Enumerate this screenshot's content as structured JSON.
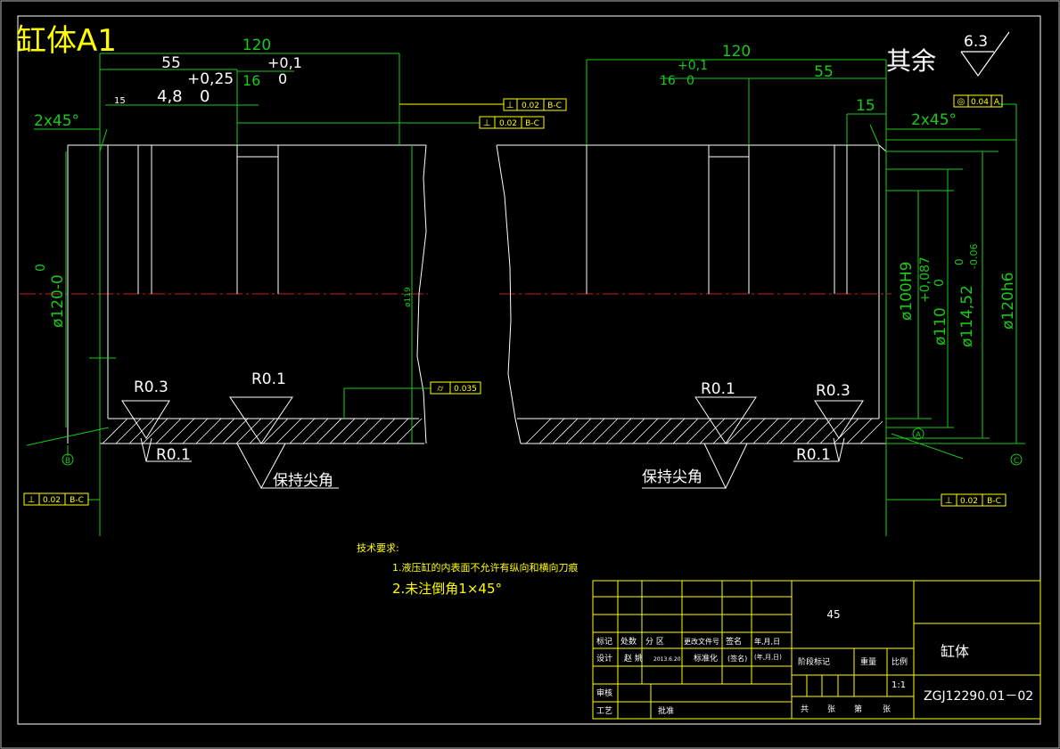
{
  "title": "缸体A1",
  "surface_finish": {
    "label": "其余",
    "value": "6.3"
  },
  "colors": {
    "background": "#000000",
    "dimension": "#19c819",
    "outline": "#ffffff",
    "text": "#ffff00",
    "centerline": "#c81e1e"
  },
  "left_dims": {
    "overall": "120",
    "d55": "55",
    "tol_025": "+0,25",
    "tol_01_top": "+0,1",
    "d16": "16",
    "zero_a": "0",
    "d15": "15",
    "d48": "4,8",
    "zero_b": "0",
    "chamfer": "2x45°",
    "diameter_left": "ø120-0",
    "diameter_left_tol": "0",
    "diameter_mid": "ø119",
    "radius_03": "R0.3",
    "radius_01_top": "R0.1",
    "radius_01_bot": "R0.1",
    "sharp_corner": "保持尖角",
    "fcf_1": [
      "⊥",
      "0.02",
      "B-C"
    ],
    "fcf_2": [
      "⊥",
      "0.02",
      "B-C"
    ],
    "fcf_3": [
      "⌭",
      "0.035"
    ],
    "datum_b": "B"
  },
  "right_dims": {
    "overall": "120",
    "d55": "55",
    "tol_01": "+0,1",
    "d16": "16",
    "zero_a": "0",
    "d15": "15",
    "chamfer": "2x45°",
    "d100": "ø100H9",
    "d110": "ø110",
    "d110_tol": "+0,087",
    "d110_tol_b": "0",
    "d114": "ø114,52",
    "d114_tol": "0",
    "d114_tol_b": "-0.06",
    "d120": "ø120h6",
    "radius_01_top": "R0.1",
    "radius_03": "R0.3",
    "radius_01_bot": "R0.1",
    "sharp_corner": "保持尖角",
    "fcf_1": [
      "◎",
      "0.04",
      "A"
    ],
    "fcf_2": [
      "⊥",
      "0.02",
      "B-C"
    ],
    "datum_a": "A",
    "datum_c": "C"
  },
  "notes": {
    "heading": "技术要求:",
    "line1": "1.液压缸的内表面不允许有纵向和横向刀痕",
    "line2": "2.未注倒角1×45°"
  },
  "title_block": {
    "material": "45",
    "part_name": "缸体",
    "drawing_no": "ZGJ12290.01－02",
    "scale": "1:1",
    "row_labels": [
      "标记",
      "处数",
      "分 区",
      "更改文件号",
      "签名",
      "年,月,日"
    ],
    "design_row": [
      "设计",
      "赵 姚",
      "2013.6.20",
      "标准化",
      "(签名)",
      "(年,月,日)"
    ],
    "stage_label": "阶段标记",
    "weight_label": "重量",
    "scale_label": "比例",
    "review_label": "审核",
    "process_label": "工艺",
    "approve_label": "批准",
    "sheets": [
      "共",
      "张",
      "第",
      "张"
    ]
  }
}
